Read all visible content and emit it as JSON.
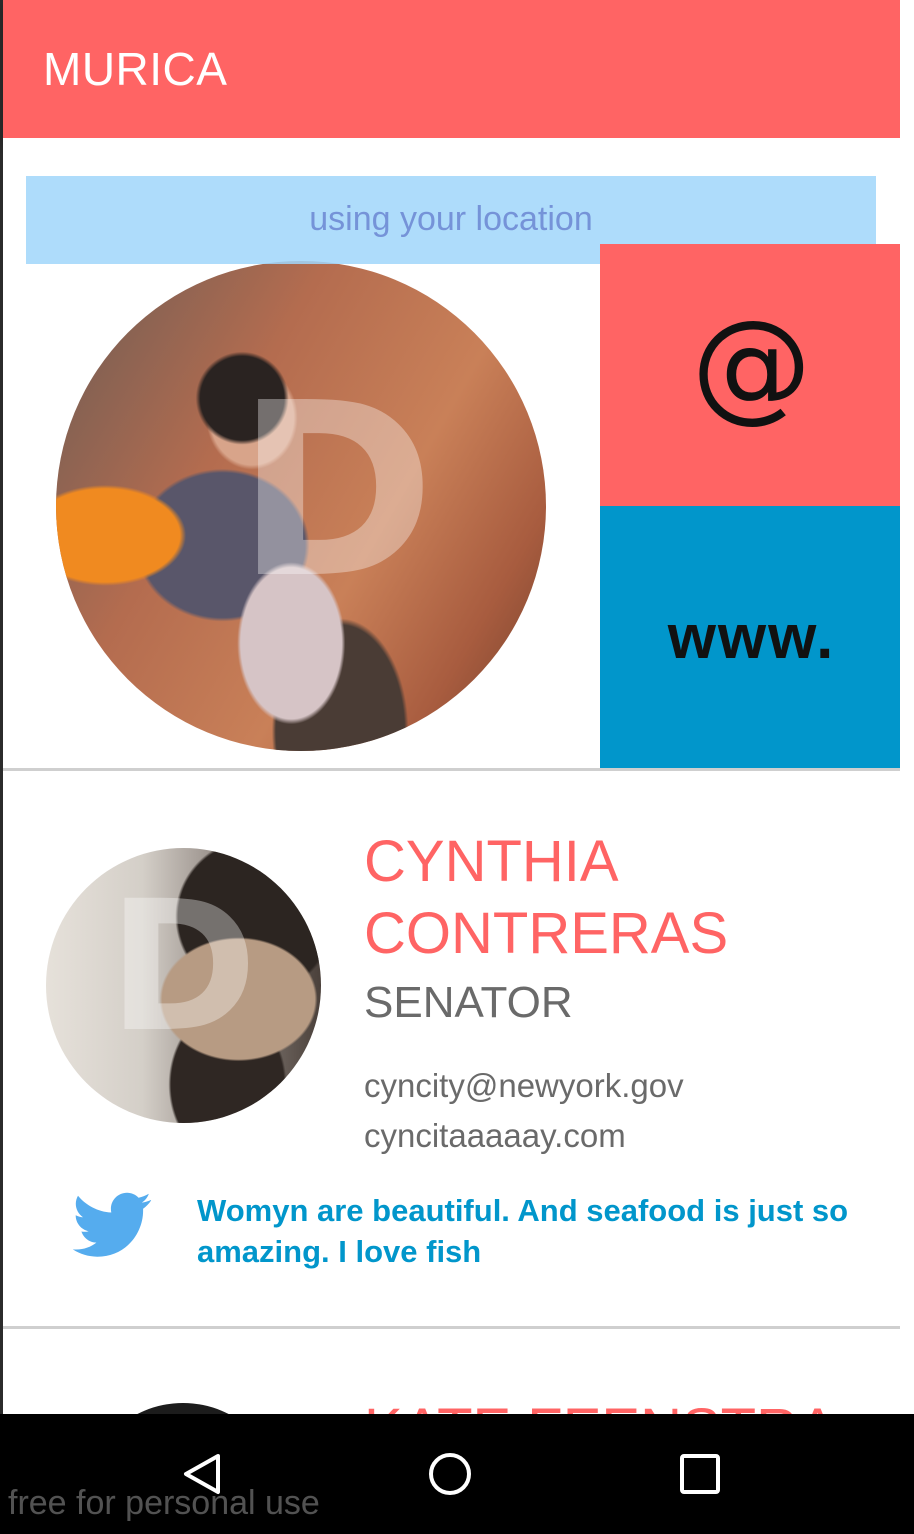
{
  "app_bar": {
    "title": "MURICA",
    "color": "#ff6464"
  },
  "location_banner": {
    "text": "using your location"
  },
  "featured": {
    "email_tile": {
      "label": "@",
      "color": "#ff6464"
    },
    "web_tile": {
      "label": "www.",
      "color": "#0196cb"
    }
  },
  "rep": {
    "name": "CYNTHIA CONTRERAS",
    "role": "SENATOR",
    "email": "cyncity@newyork.gov",
    "website": "cyncitaaaaay.com",
    "tweet": "Womyn are beautiful. And seafood is just so amazing. I love fish"
  },
  "next_rep": {
    "name": "KATE FEENSTRA"
  },
  "nav": {
    "back": "back-icon",
    "home": "home-icon",
    "recents": "recents-icon"
  },
  "watermark": "free for personal use"
}
